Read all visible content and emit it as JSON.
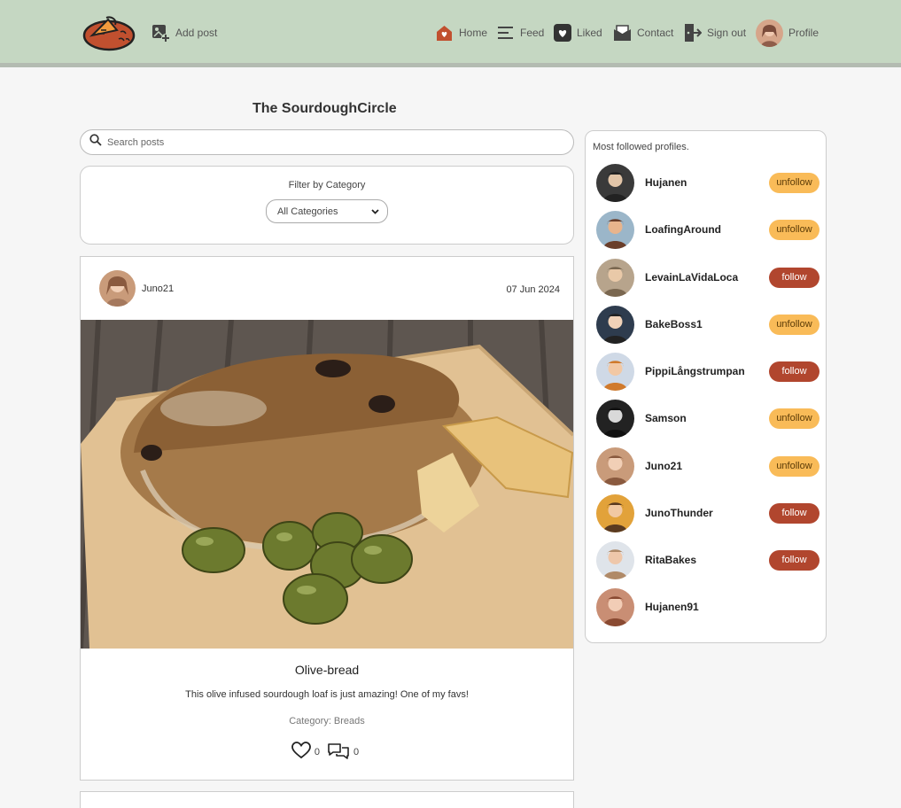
{
  "nav": {
    "add_post": "Add post",
    "home": "Home",
    "feed": "Feed",
    "liked": "Liked",
    "contact": "Contact",
    "sign_out": "Sign out",
    "profile": "Profile"
  },
  "site_title": "The SourdoughCircle",
  "search": {
    "placeholder": "Search posts"
  },
  "filter": {
    "label": "Filter by Category",
    "selected": "All Categories"
  },
  "post": {
    "author": "Juno21",
    "date": "07 Jun 2024",
    "title": "Olive-bread",
    "description": "This olive infused sourdough loaf is just amazing! One of my favs!",
    "category": "Category: Breads",
    "likes": "0",
    "comments": "0"
  },
  "sidebar": {
    "heading": "Most followed profiles.",
    "profiles": [
      {
        "name": "Hujanen",
        "button": "unfollow"
      },
      {
        "name": "LoafingAround",
        "button": "unfollow"
      },
      {
        "name": "LevainLaVidaLoca",
        "button": "follow"
      },
      {
        "name": "BakeBoss1",
        "button": "unfollow"
      },
      {
        "name": "PippiLångstrumpan",
        "button": "follow"
      },
      {
        "name": "Samson",
        "button": "unfollow"
      },
      {
        "name": "Juno21",
        "button": "unfollow"
      },
      {
        "name": "JunoThunder",
        "button": "follow"
      },
      {
        "name": "RitaBakes",
        "button": "follow"
      },
      {
        "name": "Hujanen91",
        "button": ""
      }
    ]
  },
  "colors": {
    "navbar": "#c5d7c2",
    "accent_red": "#b1462e",
    "accent_yellow": "#f9bb58",
    "background": "#f6f6f6"
  }
}
